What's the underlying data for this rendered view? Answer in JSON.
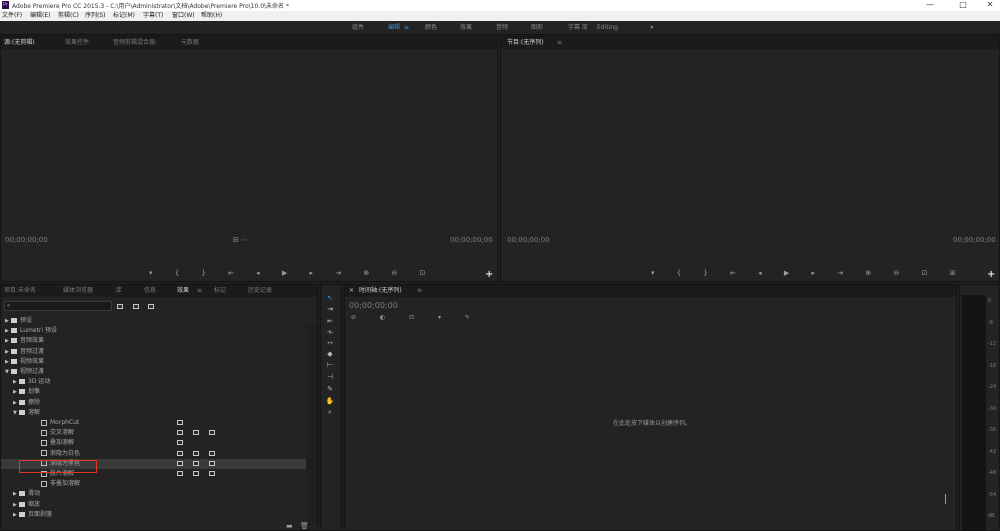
{
  "window": {
    "logo": "Pr",
    "title": "Adobe Premiere Pro CC 2015.3 - C:\\用户\\Administrator\\文档\\Adobe\\Premiere Pro\\10.0\\未命名 *",
    "min": "—",
    "max": "□",
    "close": "✕"
  },
  "menu": [
    "文件(F)",
    "编辑(E)",
    "剪辑(C)",
    "序列(S)",
    "标记(M)",
    "字幕(T)",
    "窗口(W)",
    "帮助(H)"
  ],
  "workspaces": {
    "items": [
      "组件",
      "编辑",
      "颜色",
      "效果",
      "音频",
      "图形",
      "字幕",
      "库",
      "Editing"
    ],
    "active": "编辑",
    "more": "»"
  },
  "source": {
    "tabs": [
      "源:(无剪辑)",
      "效果控件",
      "音频剪辑混合器:",
      "元数据"
    ],
    "timecode_left": "00;00;00;00",
    "timecode_right": "00;00;00;00"
  },
  "program": {
    "tab": "节目:(无序列)",
    "timecode_left": "00;00;00;00",
    "timecode_right": "00;00;00;00"
  },
  "project": {
    "tabs": [
      "项目:未命名",
      "媒体浏览器",
      "库",
      "信息",
      "效果",
      "标记",
      "历史记录"
    ],
    "active_tab": "效果",
    "search_placeholder": "",
    "tree": [
      {
        "label": "预设",
        "level": 0,
        "type": "folder"
      },
      {
        "label": "Lumetri 预设",
        "level": 0,
        "type": "folder"
      },
      {
        "label": "音频效果",
        "level": 0,
        "type": "folder"
      },
      {
        "label": "音频过渡",
        "level": 0,
        "type": "folder"
      },
      {
        "label": "视频效果",
        "level": 0,
        "type": "folder"
      },
      {
        "label": "视频过渡",
        "level": 0,
        "type": "folder",
        "open": true
      },
      {
        "label": "3D 运动",
        "level": 1,
        "type": "folder"
      },
      {
        "label": "划像",
        "level": 1,
        "type": "folder"
      },
      {
        "label": "擦除",
        "level": 1,
        "type": "folder"
      },
      {
        "label": "溶解",
        "level": 1,
        "type": "folder",
        "open": true
      },
      {
        "label": "MorphCut",
        "level": 2,
        "type": "fx",
        "badges": 1
      },
      {
        "label": "交叉溶解",
        "level": 2,
        "type": "fx",
        "badges": 3
      },
      {
        "label": "叠加溶解",
        "level": 2,
        "type": "fx",
        "badges": 1
      },
      {
        "label": "渐隐为白色",
        "level": 2,
        "type": "fx",
        "badges": 3
      },
      {
        "label": "渐隐为黑色",
        "level": 2,
        "type": "fx",
        "badges": 3,
        "selected": true
      },
      {
        "label": "胶片溶解",
        "level": 2,
        "type": "fx",
        "badges": 3
      },
      {
        "label": "非叠加溶解",
        "level": 2,
        "type": "fx",
        "badges": 0
      },
      {
        "label": "滑动",
        "level": 1,
        "type": "folder"
      },
      {
        "label": "缩放",
        "level": 1,
        "type": "folder"
      },
      {
        "label": "页面剥落",
        "level": 1,
        "type": "folder"
      }
    ]
  },
  "timeline": {
    "tab": "时间轴:(无序列)",
    "timecode": "00;00;00;00",
    "drop_hint": "在此处放下媒体以创建序列。"
  },
  "meter": {
    "ticks": [
      "0",
      "-6",
      "-12",
      "-18",
      "-24",
      "-30",
      "-36",
      "-42",
      "-48",
      "-54",
      "dB"
    ]
  },
  "colors": {
    "accent": "#3d8fd6",
    "selection_outline": "#e0332a",
    "panel_bg": "#232323"
  }
}
